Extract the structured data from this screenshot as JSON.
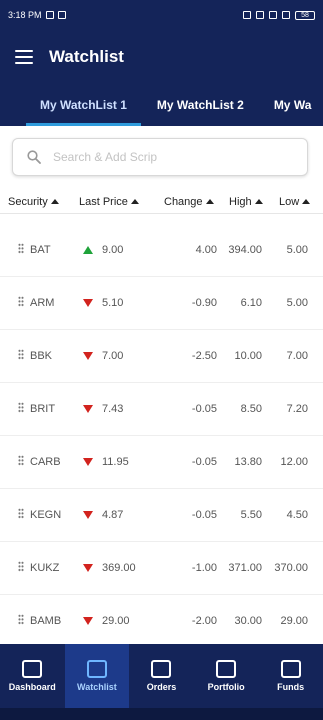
{
  "status_bar": {
    "time": "3:18 PM",
    "battery": "58"
  },
  "app_bar": {
    "title": "Watchlist"
  },
  "tabs": [
    {
      "label": "My WatchList 1",
      "active": true
    },
    {
      "label": "My WatchList 2",
      "active": false
    },
    {
      "label": "My Wa",
      "active": false
    }
  ],
  "search": {
    "placeholder": "Search & Add Scrip"
  },
  "columns": {
    "security": "Security",
    "last_price": "Last Price",
    "change": "Change",
    "high": "High",
    "low": "Low"
  },
  "rows": [
    {
      "symbol": "BAT",
      "direction": "up",
      "last_price": "9.00",
      "change": "4.00",
      "high": "394.00",
      "low": "5.00"
    },
    {
      "symbol": "ARM",
      "direction": "down",
      "last_price": "5.10",
      "change": "-0.90",
      "high": "6.10",
      "low": "5.00"
    },
    {
      "symbol": "BBK",
      "direction": "down",
      "last_price": "7.00",
      "change": "-2.50",
      "high": "10.00",
      "low": "7.00"
    },
    {
      "symbol": "BRIT",
      "direction": "down",
      "last_price": "7.43",
      "change": "-0.05",
      "high": "8.50",
      "low": "7.20"
    },
    {
      "symbol": "CARB",
      "direction": "down",
      "last_price": "11.95",
      "change": "-0.05",
      "high": "13.80",
      "low": "12.00"
    },
    {
      "symbol": "KEGN",
      "direction": "down",
      "last_price": "4.87",
      "change": "-0.05",
      "high": "5.50",
      "low": "4.50"
    },
    {
      "symbol": "KUKZ",
      "direction": "down",
      "last_price": "369.00",
      "change": "-1.00",
      "high": "371.00",
      "low": "370.00"
    },
    {
      "symbol": "BAMB",
      "direction": "down",
      "last_price": "29.00",
      "change": "-2.00",
      "high": "30.00",
      "low": "29.00"
    }
  ],
  "bottom_nav": [
    {
      "label": "Dashboard",
      "icon": "dashboard-icon",
      "active": false
    },
    {
      "label": "Watchlist",
      "icon": "watchlist-icon",
      "active": true
    },
    {
      "label": "Orders",
      "icon": "orders-icon",
      "active": false
    },
    {
      "label": "Portfolio",
      "icon": "portfolio-icon",
      "active": false
    },
    {
      "label": "Funds",
      "icon": "funds-icon",
      "active": false
    }
  ],
  "colors": {
    "primary": "#142459",
    "active_tab_underline": "#2f9bdc",
    "up": "#1fa33a",
    "down": "#d2231e"
  }
}
